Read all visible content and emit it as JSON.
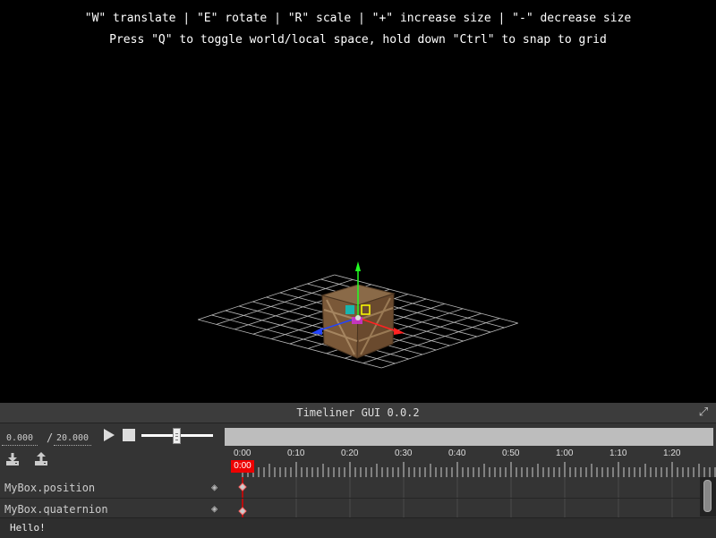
{
  "viewport": {
    "help_line_1": "\"W\" translate | \"E\" rotate | \"R\" scale | \"+\" increase size | \"-\" decrease size",
    "help_line_2": "Press \"Q\" to toggle world/local space, hold down \"Ctrl\" to snap to grid",
    "gizmo_colors": {
      "x": "#ff2222",
      "y": "#22ff22",
      "z": "#2244ff"
    }
  },
  "timeliner": {
    "title": "Timeliner GUI 0.0.2",
    "current_time": "0.000",
    "separator": "/",
    "total_time": "20.000",
    "playhead_label": "0:00",
    "ruler_labels": [
      "0:00",
      "0:10",
      "0:20",
      "0:30",
      "0:40",
      "0:50",
      "1:00",
      "1:10",
      "1:20"
    ],
    "zoom_level": 0.5,
    "accent": "#e00000",
    "tracks": [
      {
        "label": "MyBox.position",
        "toggle_icon": "diamond-icon"
      },
      {
        "label": "MyBox.quaternion",
        "toggle_icon": "diamond-icon"
      }
    ],
    "icons": {
      "play": "play-icon",
      "stop": "stop-icon",
      "import": "import-icon",
      "export": "export-icon",
      "expand": "expand-icon"
    }
  },
  "status": {
    "text": "Hello!"
  }
}
